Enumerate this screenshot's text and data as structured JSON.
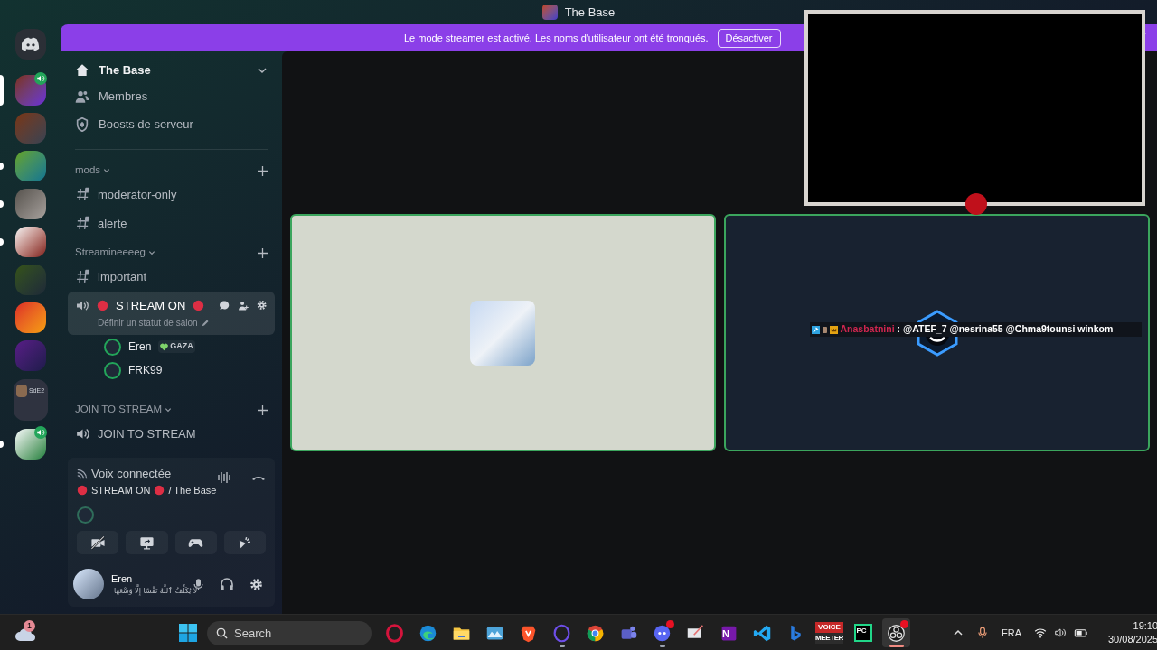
{
  "window": {
    "title": "The Base"
  },
  "servers": [
    {
      "selected": true,
      "unread": false,
      "voice": true
    },
    {
      "selected": false,
      "unread": false,
      "voice": false
    },
    {
      "selected": false,
      "unread": true,
      "voice": false
    },
    {
      "selected": false,
      "unread": true,
      "voice": false
    },
    {
      "selected": false,
      "unread": true,
      "voice": false
    },
    {
      "selected": false,
      "unread": false,
      "voice": false
    },
    {
      "selected": false,
      "unread": false,
      "voice": false
    },
    {
      "selected": false,
      "unread": false,
      "voice": false
    },
    {
      "selected": false,
      "unread": false,
      "voice": false,
      "label": "SdE2"
    },
    {
      "selected": false,
      "unread": true,
      "voice": true
    }
  ],
  "banner": {
    "message": "Le mode streamer est activé. Les noms d'utilisateur ont été tronqués.",
    "button": "Désactiver"
  },
  "sidebar": {
    "server_name": "The Base",
    "items": [
      {
        "kind": "members",
        "label": "Membres"
      },
      {
        "kind": "boost",
        "label": "Boosts de serveur"
      }
    ],
    "categories": [
      {
        "name": "mods",
        "channels": [
          {
            "kind": "text",
            "name": "moderator-only",
            "selected": false
          },
          {
            "kind": "text",
            "name": "alerte",
            "selected": false
          }
        ]
      },
      {
        "name": "Streamineeeeg",
        "channels": [
          {
            "kind": "text",
            "name": "important",
            "selected": false
          },
          {
            "kind": "voice",
            "name": "STREAM ON",
            "selected": true,
            "status": "Définir un statut de salon",
            "users": [
              {
                "name": "Eren",
                "badge": "GAZA"
              },
              {
                "name": "FRK99"
              }
            ]
          }
        ]
      },
      {
        "name": "JOIN TO STREAM",
        "channels": [
          {
            "kind": "voice",
            "name": "JOIN TO STREAM",
            "selected": false
          }
        ]
      }
    ]
  },
  "voice_panel": {
    "title": "Voix connectée",
    "channel": "STREAM ON",
    "server": "/ The Base"
  },
  "user_panel": {
    "name": "Eren",
    "status": "لَا يُكَلِّفُ ٱللَّهُ نَفْسًا إِلَّا وُسْعَهَا"
  },
  "tiles": [
    {
      "kind": "avatar",
      "speaking": true
    },
    {
      "kind": "stream",
      "speaking": true,
      "chat": {
        "user": "Anasbatnini",
        "message": ": @ATEF_7 @nesrina55 @Chma9tounsi winkom"
      }
    }
  ],
  "taskbar": {
    "weather_badge": "1",
    "search_placeholder": "Search",
    "apps": [
      {
        "kind": "opera",
        "running": false,
        "selected": false,
        "alert": false
      },
      {
        "kind": "edge",
        "running": false,
        "selected": false,
        "alert": false
      },
      {
        "kind": "folder",
        "running": false,
        "selected": false,
        "alert": false
      },
      {
        "kind": "photos",
        "running": false,
        "selected": false,
        "alert": false
      },
      {
        "kind": "brave",
        "running": false,
        "selected": false,
        "alert": false
      },
      {
        "kind": "operagx",
        "running": true,
        "selected": false,
        "alert": false
      },
      {
        "kind": "chrome",
        "running": false,
        "selected": false,
        "alert": false
      },
      {
        "kind": "teams",
        "running": false,
        "selected": false,
        "alert": false
      },
      {
        "kind": "discord",
        "running": true,
        "selected": false,
        "alert": true
      },
      {
        "kind": "snip",
        "running": false,
        "selected": false,
        "alert": false
      },
      {
        "kind": "onenote",
        "running": false,
        "selected": false,
        "alert": false,
        "label": "N"
      },
      {
        "kind": "vscode",
        "running": false,
        "selected": false,
        "alert": false
      },
      {
        "kind": "bing",
        "running": false,
        "selected": false,
        "alert": false
      },
      {
        "kind": "voicemeeter",
        "running": false,
        "selected": false,
        "alert": false,
        "label_lines": [
          "VOICE",
          "MEETER"
        ]
      },
      {
        "kind": "pycharm",
        "running": false,
        "selected": false,
        "alert": false,
        "label": "PC"
      },
      {
        "kind": "obs",
        "running": true,
        "selected": true,
        "alert": true
      }
    ],
    "language": "FRA",
    "time": "19:10",
    "date": "30/08/2025"
  }
}
